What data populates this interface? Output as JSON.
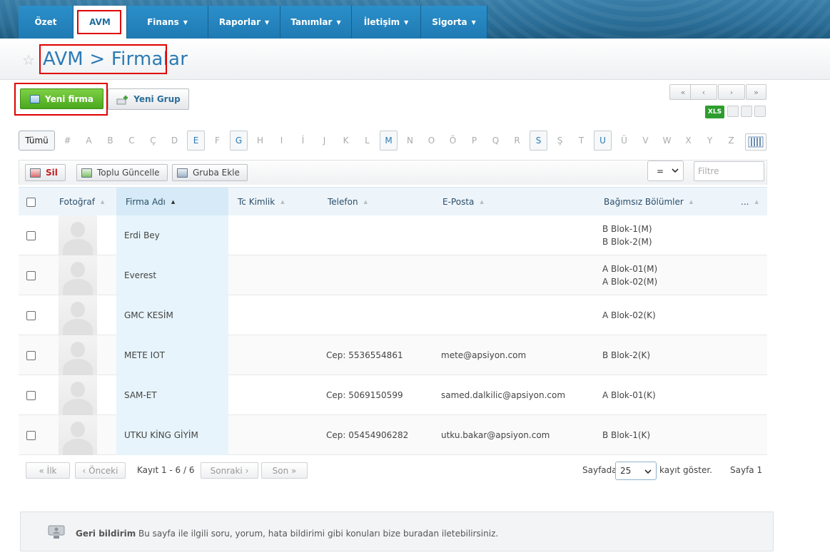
{
  "nav": {
    "items": [
      {
        "label": "Özet",
        "caret": false
      },
      {
        "label": "AVM",
        "caret": false,
        "active": true
      },
      {
        "label": "Finans",
        "caret": true
      },
      {
        "label": "Raporlar",
        "caret": true
      },
      {
        "label": "Tanımlar",
        "caret": true
      },
      {
        "label": "İletişim",
        "caret": true
      },
      {
        "label": "Sigorta",
        "caret": true
      }
    ]
  },
  "page": {
    "title": "AVM > Firmalar"
  },
  "actions": {
    "new_company": "Yeni firma",
    "new_group": "Yeni Grup"
  },
  "pager_top": {
    "first": "«",
    "prev": "‹",
    "next": "›",
    "last": "»"
  },
  "export": {
    "xls": "XLS"
  },
  "alphabet": {
    "all": "Tümü",
    "letters": [
      "#",
      "A",
      "B",
      "C",
      "Ç",
      "D",
      "E",
      "F",
      "G",
      "H",
      "I",
      "İ",
      "J",
      "K",
      "L",
      "M",
      "N",
      "O",
      "Ö",
      "P",
      "Q",
      "R",
      "S",
      "Ş",
      "T",
      "U",
      "Ü",
      "V",
      "W",
      "X",
      "Y",
      "Z"
    ],
    "enabled": [
      "E",
      "G",
      "M",
      "S",
      "U"
    ]
  },
  "toolbar": {
    "delete": "Sil",
    "bulk_update": "Toplu Güncelle",
    "add_to_group": "Gruba Ekle",
    "operator": "=",
    "filter_placeholder": "Filtre"
  },
  "table": {
    "columns": {
      "photo": "Fotoğraf",
      "company": "Firma Adı",
      "tc": "Tc Kimlik",
      "phone": "Telefon",
      "email": "E-Posta",
      "units": "Bağımsız Bölümler",
      "more": "..."
    },
    "rows": [
      {
        "company": "Erdi Bey",
        "tc": "",
        "phone": "",
        "email": "",
        "unit1": "B Blok-1(M)",
        "unit2": "B Blok-2(M)"
      },
      {
        "company": "Everest",
        "tc": "",
        "phone": "",
        "email": "",
        "unit1": "A Blok-01(M)",
        "unit2": "A Blok-02(M)"
      },
      {
        "company": "GMC KESİM",
        "tc": "",
        "phone": "",
        "email": "",
        "unit1": "A Blok-02(K)",
        "unit2": ""
      },
      {
        "company": "METE IOT",
        "tc": "",
        "phone": "Cep: 5536554861",
        "email": "mete@apsiyon.com",
        "unit1": "B Blok-2(K)",
        "unit2": ""
      },
      {
        "company": "SAM-ET",
        "tc": "",
        "phone": "Cep: 5069150599",
        "email": "samed.dalkilic@apsiyon.com",
        "unit1": "A Blok-01(K)",
        "unit2": ""
      },
      {
        "company": "UTKU KİNG GİYİM",
        "tc": "",
        "phone": "Cep: 05454906282",
        "email": "utku.bakar@apsiyon.com",
        "unit1": "B Blok-1(K)",
        "unit2": ""
      }
    ]
  },
  "footer": {
    "first": "« İlk",
    "prev": "‹ Önceki",
    "records": "Kayıt 1 - 6 / 6",
    "next": "Sonraki ›",
    "last": "Son »",
    "per_page_label": "Sayfada",
    "per_page": "25",
    "per_page_suffix": "kayıt göster.",
    "page": "Sayfa 1"
  },
  "feedback": {
    "title": "Geri bildirim",
    "text": "Bu sayfa ile ilgili soru, yorum, hata bildirimi gibi konuları bize buradan iletebilirsiniz."
  }
}
